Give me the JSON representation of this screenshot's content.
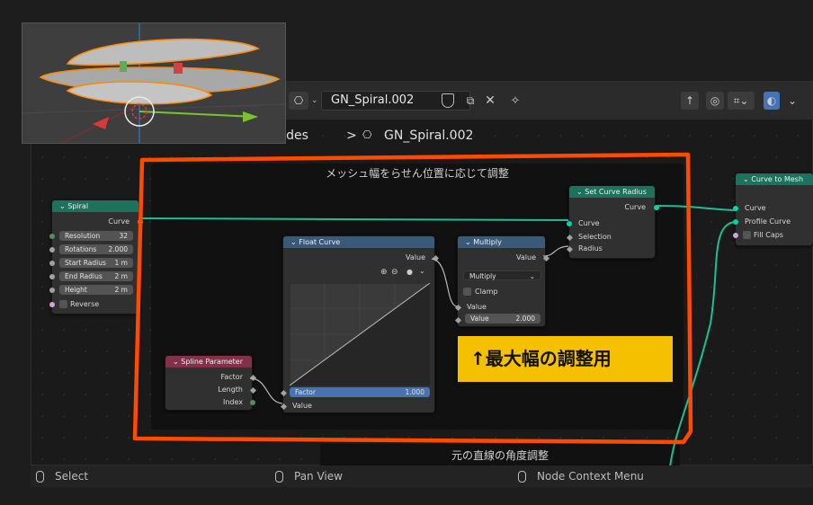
{
  "header": {
    "tree_name": "GN_Spiral.002",
    "breadcrumb_prefix": "ryNodes",
    "breadcrumb_sep": ">",
    "breadcrumb_current": "GN_Spiral.002"
  },
  "frames": {
    "main_label": "メッシュ幅をらせん位置に応じて調整",
    "bottom_label": "元の直線の角度調整",
    "note": "↑最大幅の調整用"
  },
  "nodes": {
    "spiral": {
      "title": "Spiral",
      "output": "Curve",
      "fields": [
        {
          "label": "Resolution",
          "value": "32"
        },
        {
          "label": "Rotations",
          "value": "2.000"
        },
        {
          "label": "Start Radius",
          "value": "1 m"
        },
        {
          "label": "End Radius",
          "value": "2 m"
        },
        {
          "label": "Height",
          "value": "2 m"
        }
      ],
      "reverse_label": "Reverse"
    },
    "set_curve_radius": {
      "title": "Set Curve Radius",
      "output": "Curve",
      "inputs": [
        "Curve",
        "Selection",
        "Radius"
      ]
    },
    "curve_to_mesh": {
      "title": "Curve to Mesh",
      "inputs": [
        "Curve",
        "Profile Curve",
        "Fill Caps"
      ]
    },
    "float_curve": {
      "title": "Float Curve",
      "output": "Value",
      "factor_label": "Factor",
      "factor_value": "1.000",
      "value_label": "Value"
    },
    "multiply": {
      "title": "Multiply",
      "output": "Value",
      "operation": "Multiply",
      "clamp_label": "Clamp",
      "value_label": "Value",
      "value2_label": "Value",
      "value2": "2.000"
    },
    "spline_parameter": {
      "title": "Spline Parameter",
      "outputs": [
        "Factor",
        "Length",
        "Index"
      ]
    }
  },
  "status_bar": {
    "select": "Select",
    "pan": "Pan View",
    "context": "Node Context Menu"
  },
  "colors": {
    "annotation_orange": "#ff4a00",
    "note_yellow": "#f5c000",
    "geometry_socket": "#00d6a3",
    "geometry_header": "#1d725e",
    "attribute_header": "#83314a"
  }
}
